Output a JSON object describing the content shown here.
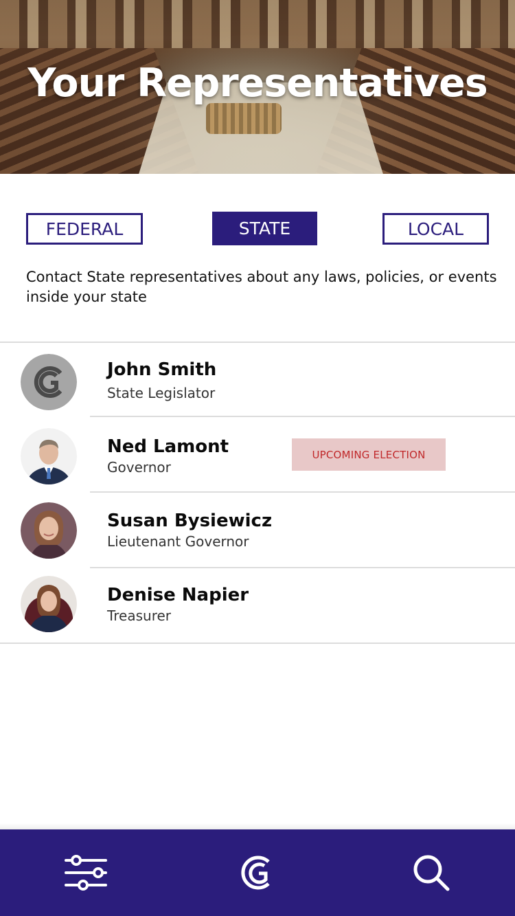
{
  "header": {
    "title": "Your Representatives"
  },
  "tabs": [
    {
      "label": "FEDERAL",
      "selected": false
    },
    {
      "label": "STATE",
      "selected": true
    },
    {
      "label": "LOCAL",
      "selected": false
    }
  ],
  "intro_text": "Contact State representatives about any laws, policies, or events inside your state",
  "representatives": [
    {
      "name": "John Smith",
      "title": "State Legislator",
      "avatar": "placeholder-g-logo"
    },
    {
      "name": "Ned Lamont",
      "title": "Governor",
      "avatar": "photo",
      "badge": "UPCOMING ELECTION"
    },
    {
      "name": "Susan Bysiewicz",
      "title": "Lieutenant Governor",
      "avatar": "photo"
    },
    {
      "name": "Denise Napier",
      "title": "Treasurer",
      "avatar": "photo"
    }
  ],
  "bottom_nav": {
    "items": [
      {
        "icon": "sliders-icon"
      },
      {
        "icon": "g-logo-icon"
      },
      {
        "icon": "search-icon"
      }
    ]
  },
  "colors": {
    "brand": "#2b1d7c",
    "badge_bg": "#e8c8c8",
    "badge_text": "#c0282a",
    "divider": "#dcdcdc"
  }
}
